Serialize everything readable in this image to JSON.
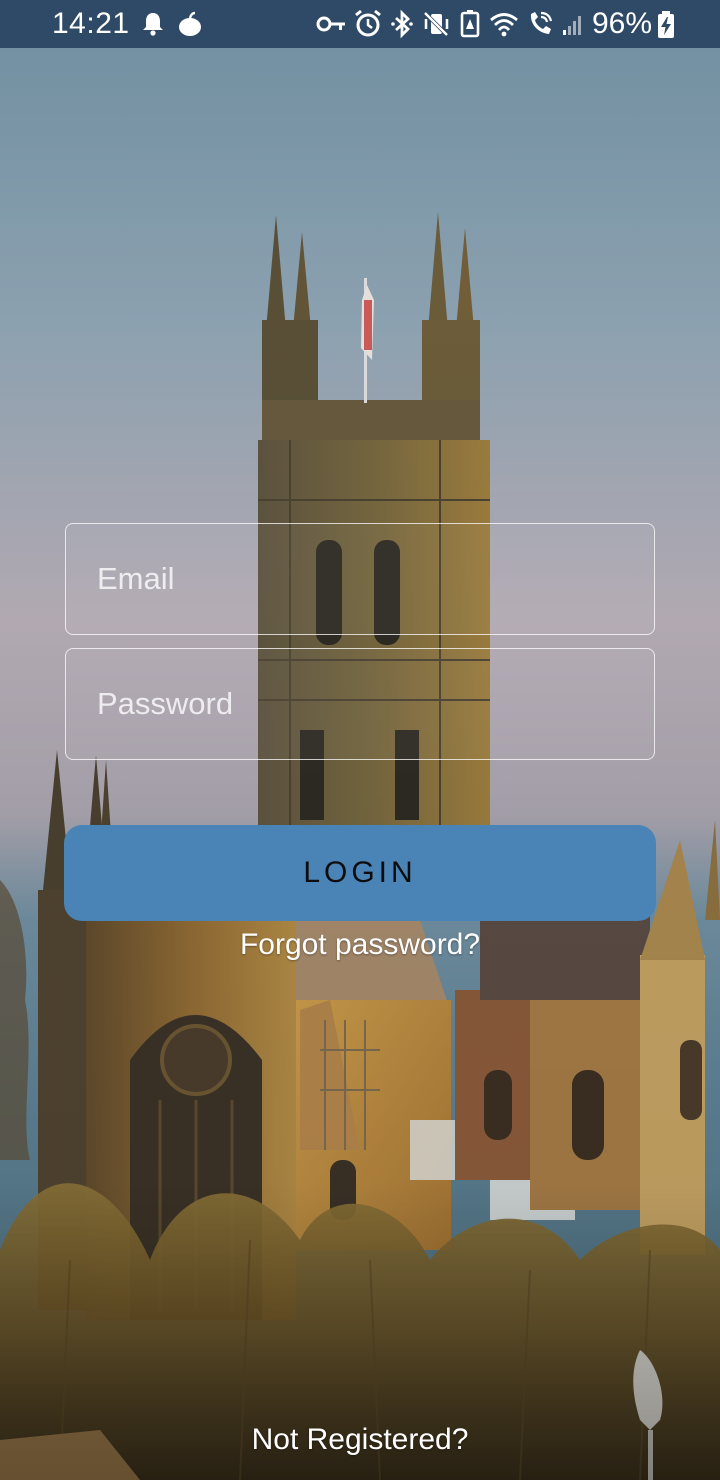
{
  "status_bar": {
    "time": "14:21",
    "battery_percent": "96%",
    "background_color": "#2f4a66",
    "left_icons": [
      "notification-bell-icon",
      "apple-app-icon"
    ],
    "right_icons": [
      "vpn-key-icon",
      "alarm-icon",
      "bluetooth-icon",
      "vibrate-icon",
      "battery-saver-icon",
      "wifi-icon",
      "wifi-calling-icon",
      "cell-signal-icon",
      "battery-charging-icon"
    ]
  },
  "login_form": {
    "email_placeholder": "Email",
    "email_value": "",
    "password_placeholder": "Password",
    "password_value": "",
    "login_label": "LOGIN",
    "forgot_password_label": "Forgot password?",
    "not_registered_label": "Not Registered?"
  },
  "colors": {
    "login_button": "#4a83b6",
    "field_border": "#ffffff"
  },
  "background": {
    "description_icon": "cathedral-photo"
  }
}
